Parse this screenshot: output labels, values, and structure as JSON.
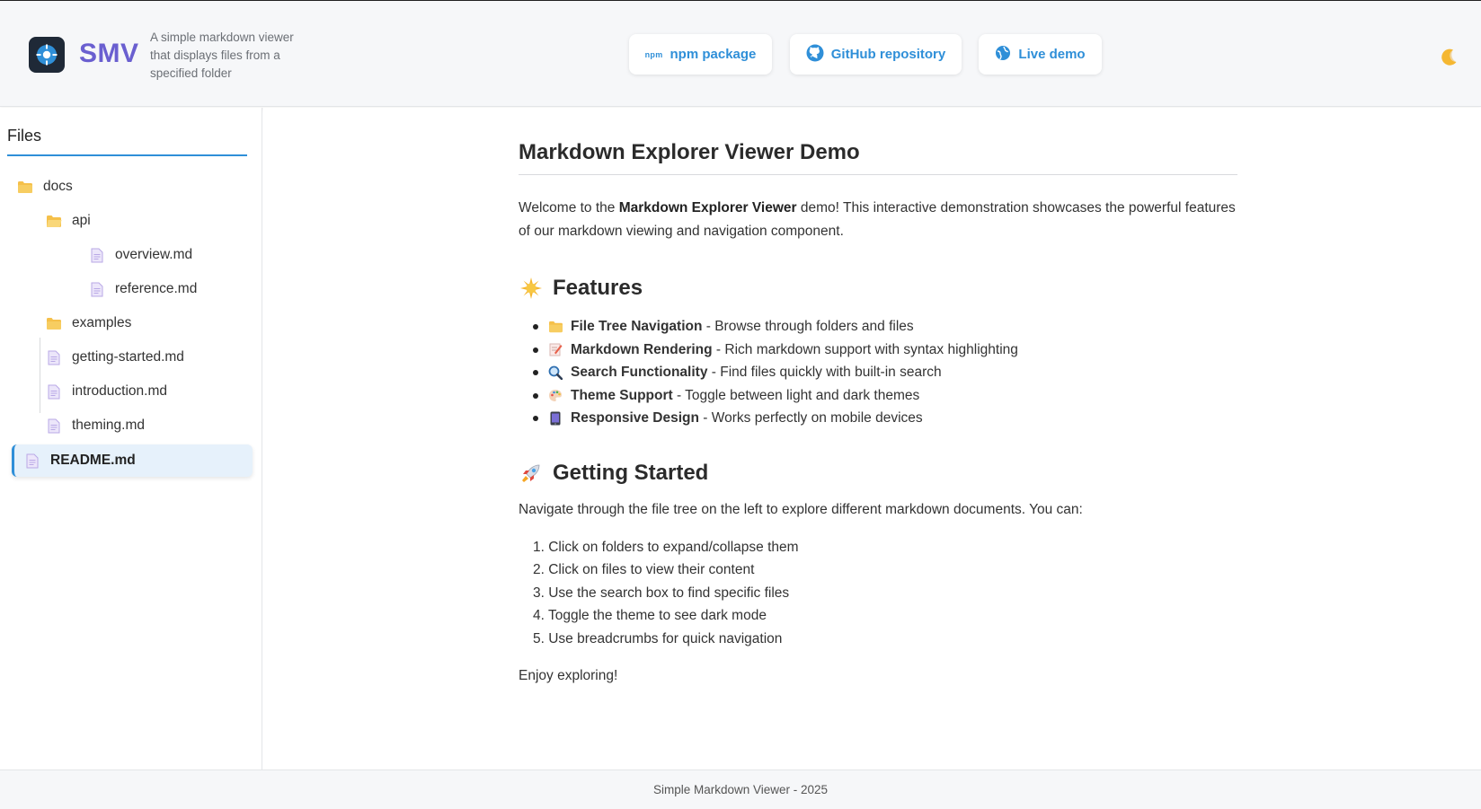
{
  "header": {
    "logo_text": "SMV",
    "tagline": "A simple markdown viewer that displays files from a specified folder",
    "buttons": [
      {
        "label": "npm package",
        "icon": "npm-icon"
      },
      {
        "label": "GitHub repository",
        "icon": "github-icon"
      },
      {
        "label": "Live demo",
        "icon": "globe-icon"
      }
    ],
    "npm_glyph": "npm",
    "theme_toggle_icon": "moon-icon"
  },
  "sidebar": {
    "title": "Files",
    "items": [
      {
        "label": "docs",
        "type": "folder",
        "depth": 0
      },
      {
        "label": "api",
        "type": "folder",
        "depth": 1
      },
      {
        "label": "overview.md",
        "type": "file",
        "depth": 2
      },
      {
        "label": "reference.md",
        "type": "file",
        "depth": 2
      },
      {
        "label": "examples",
        "type": "folder",
        "depth": 1
      },
      {
        "label": "getting-started.md",
        "type": "file",
        "depth": 1
      },
      {
        "label": "introduction.md",
        "type": "file",
        "depth": 1
      },
      {
        "label": "theming.md",
        "type": "file",
        "depth": 1
      },
      {
        "label": "README.md",
        "type": "file",
        "depth": 0,
        "active": true
      }
    ]
  },
  "doc": {
    "title": "Markdown Explorer Viewer Demo",
    "intro_prefix": "Welcome to the ",
    "intro_bold": "Markdown Explorer Viewer",
    "intro_suffix": " demo! This interactive demonstration showcases the powerful features of our markdown viewing and navigation component.",
    "features_heading": "Features",
    "features": [
      {
        "icon": "folder-icon",
        "bold": "File Tree Navigation",
        "text": " - Browse through folders and files"
      },
      {
        "icon": "memo-icon",
        "bold": "Markdown Rendering",
        "text": " - Rich markdown support with syntax highlighting"
      },
      {
        "icon": "magnifier-icon",
        "bold": "Search Functionality",
        "text": " - Find files quickly with built-in search"
      },
      {
        "icon": "palette-icon",
        "bold": "Theme Support",
        "text": " - Toggle between light and dark themes"
      },
      {
        "icon": "mobile-icon",
        "bold": "Responsive Design",
        "text": " - Works perfectly on mobile devices"
      }
    ],
    "getting_started_heading": "Getting Started",
    "getting_started_text": "Navigate through the file tree on the left to explore different markdown documents. You can:",
    "steps": [
      "1. Click on folders to expand/collapse them",
      "2. Click on files to view their content",
      "3. Use the search box to find specific files",
      "4. Toggle the theme to see dark mode",
      "5. Use breadcrumbs for quick navigation"
    ],
    "closing": "Enjoy exploring!"
  },
  "footer": {
    "text": "Simple Markdown Viewer - 2025"
  },
  "colors": {
    "accent": "#2f8fd8",
    "brand": "#6a5fd0",
    "folder": "#f5c04a",
    "file": "#b9a8e6"
  }
}
